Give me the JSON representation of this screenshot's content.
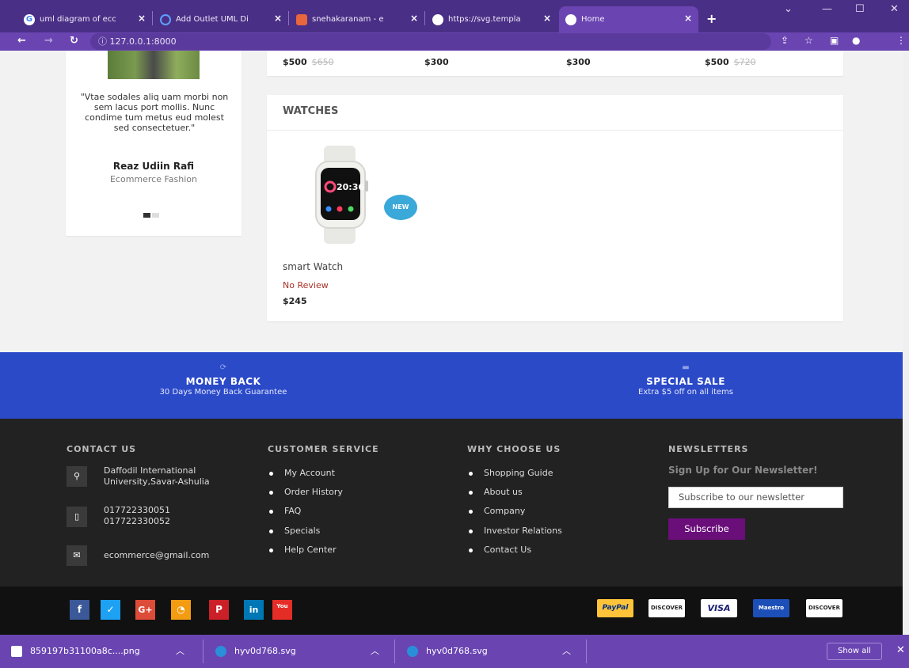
{
  "browser": {
    "tabs": [
      {
        "label": "uml diagram of ecc",
        "active": false
      },
      {
        "label": "Add Outlet UML Di",
        "active": false
      },
      {
        "label": "snehakaranam - e",
        "active": false
      },
      {
        "label": "https://svg.templa",
        "active": false
      },
      {
        "label": "Home",
        "active": true
      }
    ],
    "new_tab": "+",
    "url": "127.0.0.1:8000"
  },
  "testimonial": {
    "quote": "\"Vtae sodales aliq uam morbi non sem lacus port mollis. Nunc condime tum metus eud molest sed consectetuer.\"",
    "name": "Reaz Udiin Rafi",
    "title": "Ecommerce Fashion"
  },
  "prev_row_prices": [
    {
      "price": "$500",
      "old": "$650"
    },
    {
      "price": "$300",
      "old": ""
    },
    {
      "price": "$300",
      "old": ""
    },
    {
      "price": "$500",
      "old": "$720"
    }
  ],
  "watches": {
    "title": "WATCHES",
    "product": {
      "badge": "NEW",
      "screen_time": "20:36",
      "name": "smart Watch",
      "review": "No Review",
      "price": "$245"
    }
  },
  "features": [
    {
      "icon": "refresh-icon",
      "title": "MONEY BACK",
      "subtitle": "30 Days Money Back Guarantee"
    },
    {
      "icon": "card-icon",
      "title": "SPECIAL SALE",
      "subtitle": "Extra $5 off on all items"
    }
  ],
  "footer": {
    "contact": {
      "title": "CONTACT US",
      "address_1": "Daffodil International",
      "address_2": "University,Savar-Ashulia",
      "phone_1": "017722330051",
      "phone_2": "017722330052",
      "email": "ecommerce@gmail.com"
    },
    "customer_service": {
      "title": "CUSTOMER SERVICE",
      "links": [
        "My Account",
        "Order History",
        "FAQ",
        "Specials",
        "Help Center"
      ]
    },
    "why_choose": {
      "title": "WHY CHOOSE US",
      "links": [
        "Shopping Guide",
        "About us",
        "Company",
        "Investor Relations",
        "Contact Us"
      ]
    },
    "newsletter": {
      "title": "NEWSLETTERS",
      "subtitle": "Sign Up for Our Newsletter!",
      "placeholder": "Subscribe to our newsletter",
      "button": "Subscribe"
    }
  },
  "social": [
    {
      "icon": "facebook-icon",
      "glyph": "f",
      "color": "#3b5998"
    },
    {
      "icon": "twitter-icon",
      "glyph": "🐦",
      "color": "#1da1f2"
    },
    {
      "icon": "google-plus-icon",
      "glyph": "G+",
      "color": "#dd4b39"
    },
    {
      "icon": "rss-icon",
      "glyph": "⌇",
      "color": "#f39c12"
    },
    {
      "icon": "pinterest-icon",
      "glyph": "℗",
      "color": "#cb2027"
    },
    {
      "icon": "linkedin-icon",
      "glyph": "in",
      "color": "#0077b5"
    },
    {
      "icon": "youtube-icon",
      "glyph": "You",
      "color": "#e52d27"
    }
  ],
  "payments": [
    {
      "label": "PayPal",
      "bg": "#ffc439",
      "fg": "#003087"
    },
    {
      "label": "DISCOVER",
      "bg": "#ffffff",
      "fg": "#222222"
    },
    {
      "label": "VISA",
      "bg": "#ffffff",
      "fg": "#1a1f71"
    },
    {
      "label": "Maestro",
      "bg": "#1d4fb8",
      "fg": "#ffffff"
    },
    {
      "label": "DISCOVER",
      "bg": "#ffffff",
      "fg": "#222222"
    }
  ],
  "downloads": [
    {
      "name": "859197b31100a8c....png"
    },
    {
      "name": "hyv0d768.svg"
    },
    {
      "name": "hyv0d768.svg"
    }
  ],
  "show_all": "Show all",
  "colors": {
    "chrome": "#4a2f86",
    "blue_band": "#2b4ac8",
    "footer": "#222222",
    "subscribe": "#6a0e7a"
  }
}
